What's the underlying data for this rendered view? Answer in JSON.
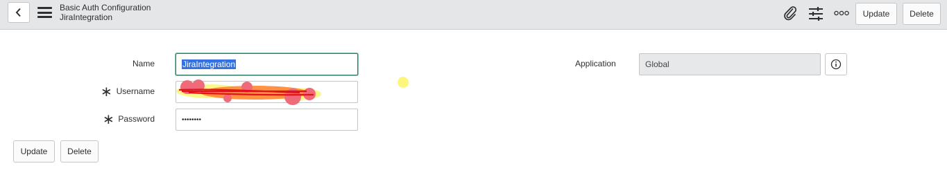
{
  "header": {
    "title": "Basic Auth Configuration",
    "subtitle": "JiraIntegration",
    "update_label": "Update",
    "delete_label": "Delete",
    "icons": [
      "back-icon",
      "menu-icon",
      "paperclip-icon",
      "sliders-icon",
      "more-options-icon"
    ]
  },
  "form": {
    "name_label": "Name",
    "name_value": "JiraIntegration",
    "username_label": "Username",
    "username_value": "",
    "password_label": "Password",
    "password_value": "••••••••",
    "required_marker": "∗",
    "application_label": "Application",
    "application_value": "Global"
  },
  "footer": {
    "update_label": "Update",
    "delete_label": "Delete"
  },
  "colors": {
    "header_bg": "#e4e6e7",
    "focus_border": "#2f7d6a",
    "selection": "#3372df",
    "readonly_bg": "#e6e8ea",
    "redaction_red": "#f04a4a",
    "redaction_orange": "#ff8c3a",
    "highlight_yellow": "#fbf77e"
  }
}
